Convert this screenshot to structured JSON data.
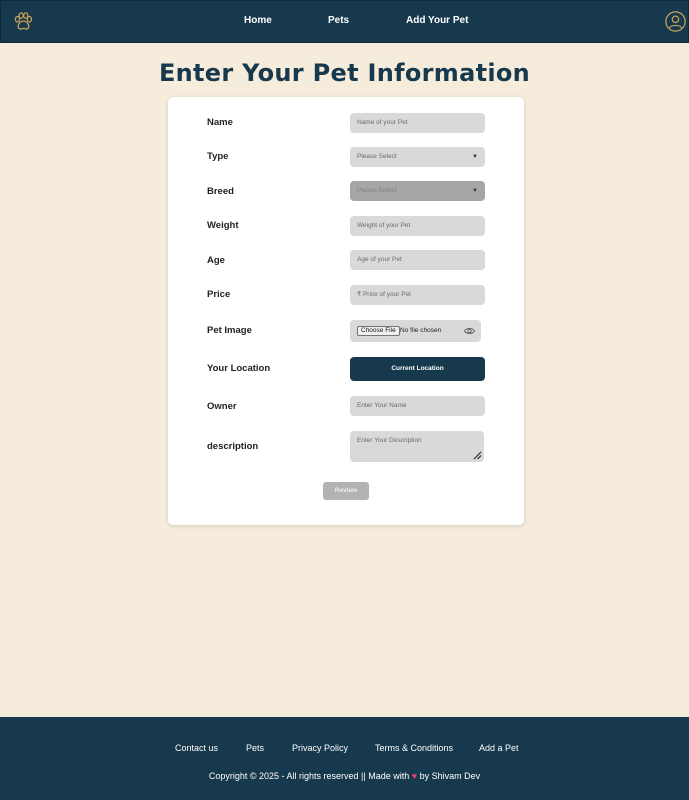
{
  "nav": {
    "logo_icon": "paw-icon",
    "links": [
      "Home",
      "Pets",
      "Add Your Pet"
    ],
    "profile_icon": "user-icon"
  },
  "title": "Enter Your Pet Information",
  "form": {
    "name": {
      "label": "Name",
      "placeholder": "Name of your Pet"
    },
    "type": {
      "label": "Type",
      "value": "Please Select"
    },
    "breed": {
      "label": "Breed",
      "value": "Please Select",
      "disabled": true
    },
    "weight": {
      "label": "Weight",
      "placeholder": "Weight of your Pet"
    },
    "age": {
      "label": "Age",
      "placeholder": "Age of your Pet"
    },
    "price": {
      "label": "Price",
      "placeholder": "₹ Price of your Pet"
    },
    "image": {
      "label": "Pet Image",
      "button": "Choose File",
      "status": "No file chosen",
      "icon": "eye-icon"
    },
    "location": {
      "label": "Your Location",
      "button": "Current Location"
    },
    "owner": {
      "label": "Owner",
      "placeholder": "Enter Your Name"
    },
    "description": {
      "label": "description",
      "placeholder": "Enter Your Description"
    },
    "submit": "Review"
  },
  "footer": {
    "links": [
      "Contact us",
      "Pets",
      "Privacy Policy",
      "Terms & Conditions",
      "Add a Pet"
    ],
    "copyright_prefix": "Copyright © 2025 - All rights reserved || Made with",
    "heart": "♥",
    "copyright_suffix": "by Shivam Dev"
  },
  "colors": {
    "navy": "#17394d",
    "background": "#f5ecdc",
    "accent": "#c9a25a",
    "heart": "#e8406d"
  }
}
